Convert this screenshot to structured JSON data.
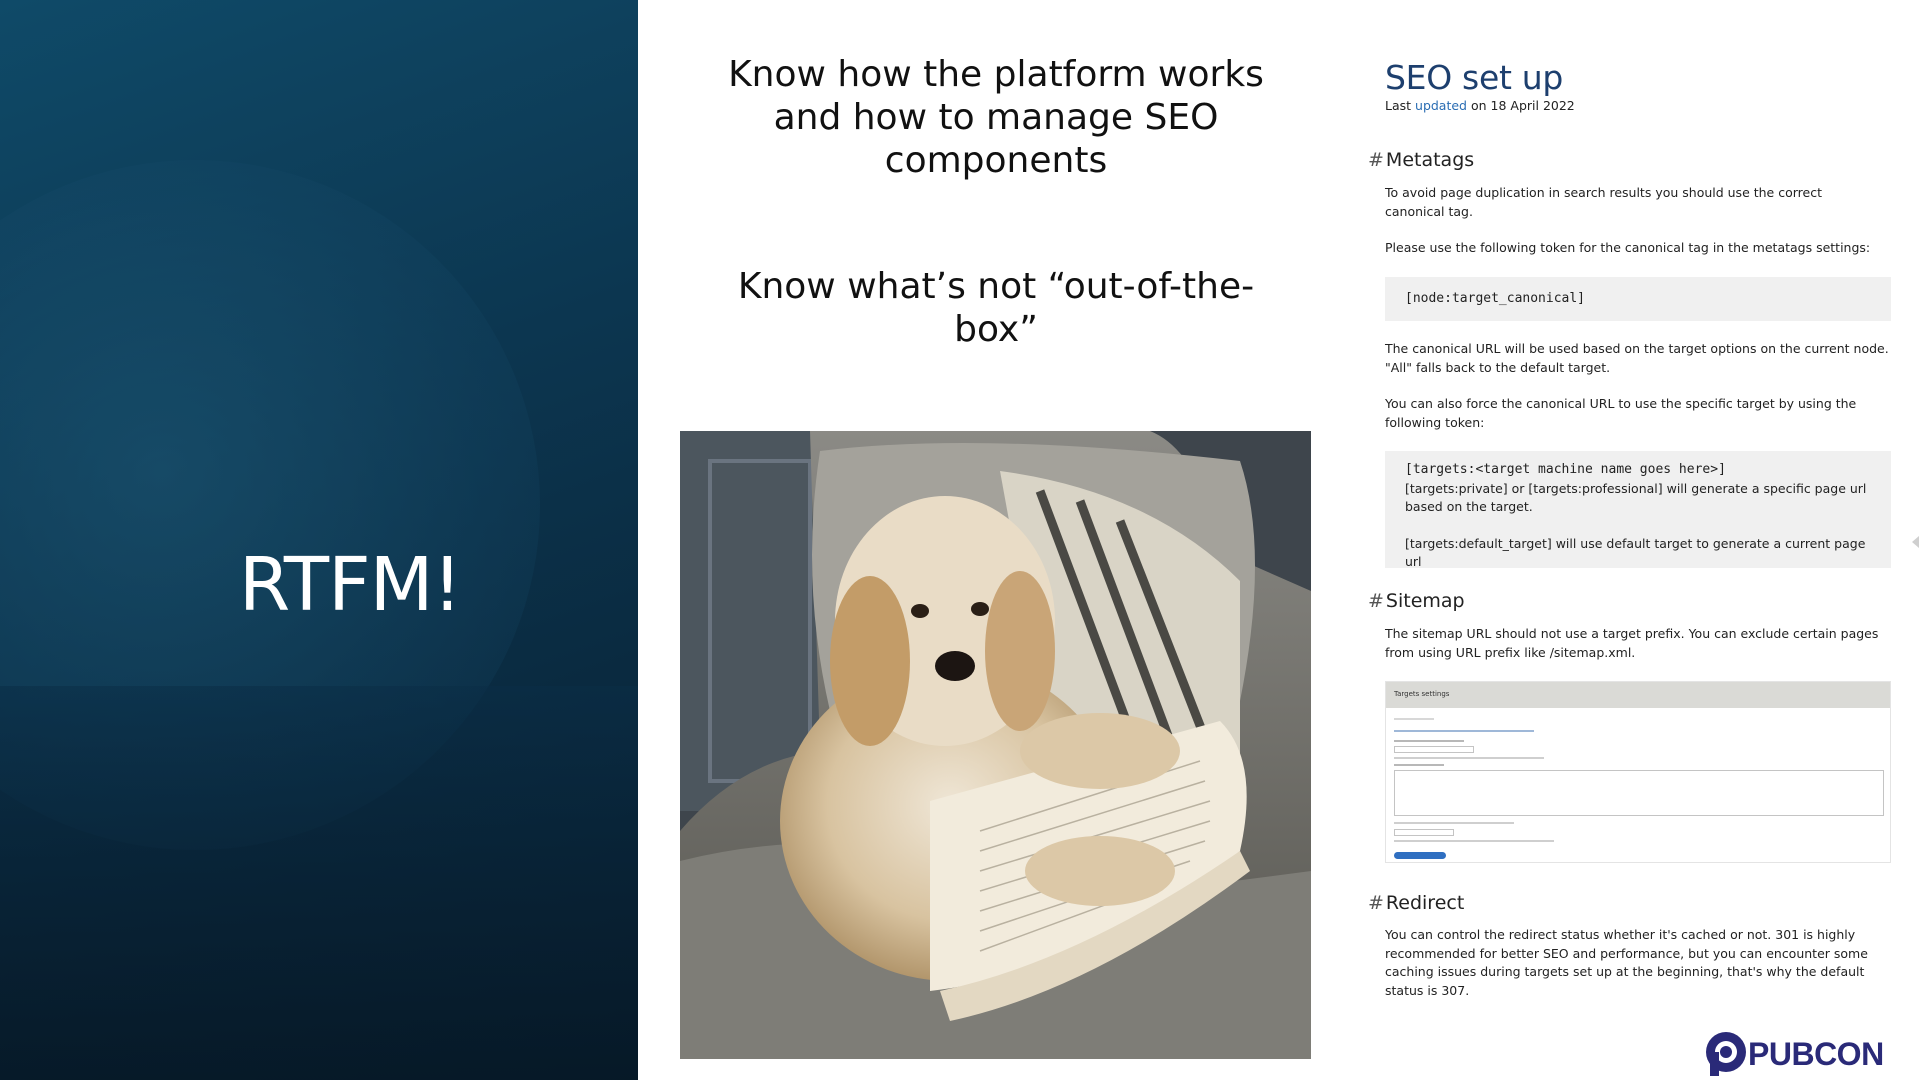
{
  "left": {
    "title": "RTFM!"
  },
  "middle": {
    "heading_1": "Know how the platform works and how to manage SEO components",
    "heading_2": "Know what’s not “out-of-the-box”"
  },
  "doc": {
    "title": "SEO set up",
    "updated_prefix": "Last ",
    "updated_link": "updated",
    "updated_suffix": " on 18 April 2022",
    "metatags": {
      "heading": "Metatags",
      "p1": "To avoid page duplication in search results you should use the correct canonical tag.",
      "p2": "Please use the following token for the canonical tag in the metatags settings:",
      "code_token": "[node:target_canonical]",
      "p3": "The canonical URL will be used based on the target options on the current node. \"All\" falls back to the default target.",
      "p4": "You can also force the canonical URL to use the specific target by using the following token:",
      "code2_line1": "[targets:<target machine name goes here>]",
      "code2_line2": "[targets:private] or [targets:professional] will generate a specific page url based on the target.",
      "code2_line3": "[targets:default_target] will use default target to generate a current page url"
    },
    "sitemap": {
      "heading": "Sitemap",
      "p1": "The sitemap URL should not use a target prefix. You can exclude certain pages from using URL prefix like /sitemap.xml.",
      "screenshot_title": "Targets settings"
    },
    "redirect": {
      "heading": "Redirect",
      "p1": "You can control the redirect status whether it's cached or not. 301 is highly recommended for better SEO and performance, but you can encounter some caching issues during targets set up at the beginning, that's why the default status is 307."
    },
    "hash": "#"
  },
  "brand": {
    "logo_text": "PUBCON"
  }
}
